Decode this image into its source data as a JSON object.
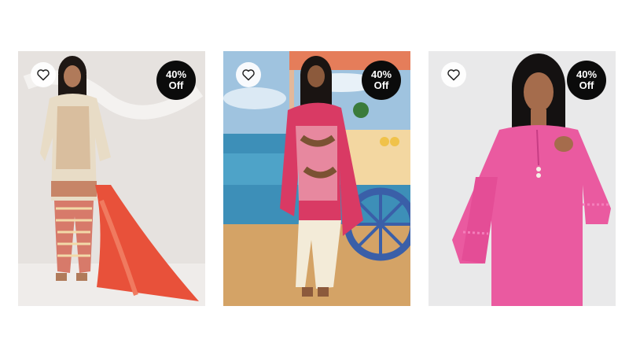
{
  "products": [
    {
      "discount_line1": "40%",
      "discount_line2": "Off",
      "wishlist_icon": "heart-outline-icon"
    },
    {
      "discount_line1": "40%",
      "discount_line2": "Off",
      "wishlist_icon": "heart-outline-icon"
    },
    {
      "discount_line1": "40%",
      "discount_line2": "Off",
      "wishlist_icon": "heart-outline-icon"
    }
  ],
  "colors": {
    "badge_bg": "#0b0b0b",
    "badge_text": "#ffffff",
    "wishlist_bg": "#ffffff"
  }
}
